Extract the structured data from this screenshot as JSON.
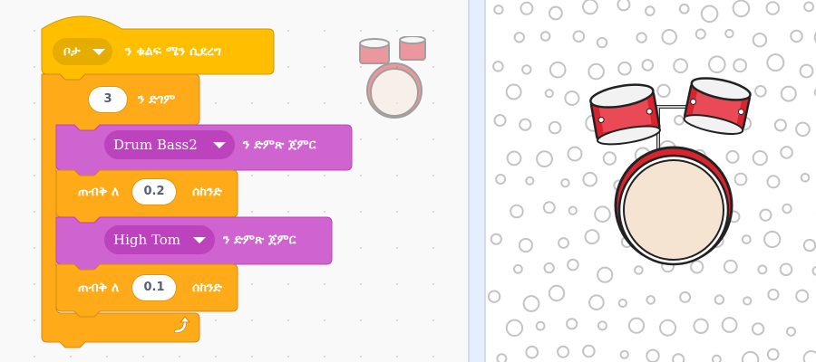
{
  "code": {
    "hat_block": {
      "key_value": "ቦታ",
      "label": "ን ቁልፍ ሜን ሲደረግ"
    },
    "repeat_block": {
      "count": "3",
      "label": "ን ድገም"
    },
    "play_drum_1": {
      "drum": "Drum Bass2",
      "label": "ን ድምጽ ጀምር"
    },
    "wait_1": {
      "prefix": "ጠብቅ ለ",
      "value": "0.2",
      "suffix": "ሰከንድ"
    },
    "play_drum_2": {
      "drum": "High Tom",
      "label": "ን ድምጽ ጀምር"
    },
    "wait_2": {
      "prefix": "ጠብቅ ለ",
      "value": "0.1",
      "suffix": "ሰከንድ"
    },
    "loop_icon": "loop-arrow-icon"
  },
  "sprite_ghost": {
    "icon": "drum-kit-icon"
  },
  "stage": {
    "sprite_icon": "drum-kit-icon",
    "backdrop": "bubbles-backdrop"
  },
  "colors": {
    "events": "#ffbf00",
    "control": "#ffab19",
    "sound": "#cf63cf",
    "sound_dark": "#bd42bd"
  }
}
